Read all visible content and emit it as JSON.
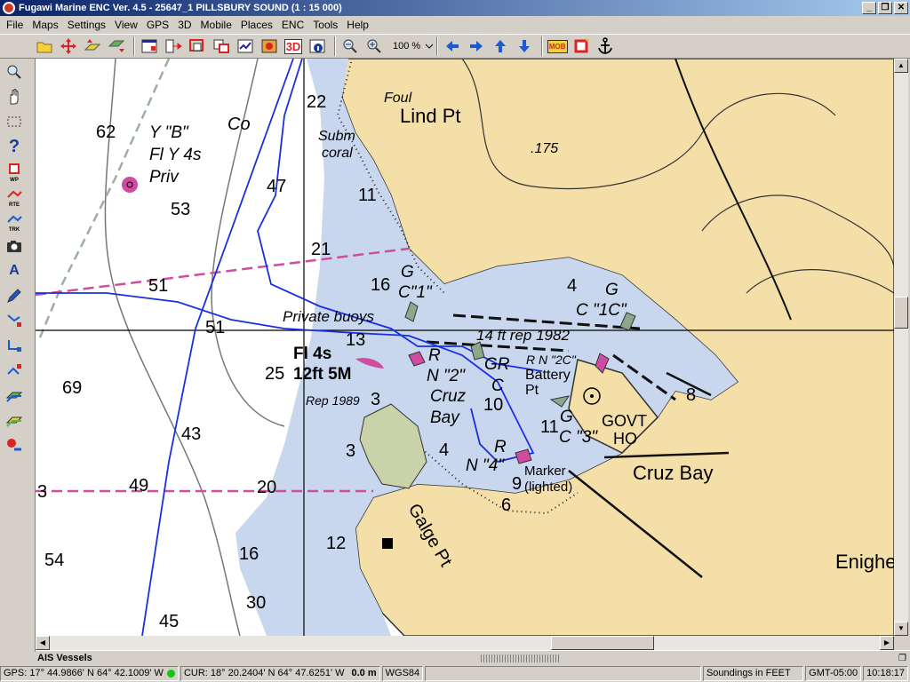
{
  "window": {
    "title": "Fugawi Marine ENC Ver. 4.5 - 25647_1  PILLSBURY SOUND  (1 : 15 000)",
    "buttons": [
      "_",
      "❐",
      "✕"
    ]
  },
  "menu": [
    "File",
    "Maps",
    "Settings",
    "View",
    "GPS",
    "3D",
    "Mobile",
    "Places",
    "ENC",
    "Tools",
    "Help"
  ],
  "toolbar": {
    "zoom_level": "100 %",
    "threed_label": "3D",
    "mob_label": "MOB"
  },
  "lefttools": {
    "wp_tag": "WP",
    "rte_tag": "RTE",
    "trk_tag": "TRK"
  },
  "chart": {
    "soundings": [
      {
        "v": "62"
      },
      {
        "v": "53"
      },
      {
        "v": "47"
      },
      {
        "v": "22"
      },
      {
        "v": "11"
      },
      {
        "v": "21"
      },
      {
        "v": "16"
      },
      {
        "v": "51"
      },
      {
        "v": "51"
      },
      {
        "v": "13"
      },
      {
        "v": "69"
      },
      {
        "v": "25"
      },
      {
        "v": "3"
      },
      {
        "v": "43"
      },
      {
        "v": "3"
      },
      {
        "v": "49"
      },
      {
        "v": "20"
      },
      {
        "v": "4"
      },
      {
        "v": "10"
      },
      {
        "v": "9"
      },
      {
        "v": "6"
      },
      {
        "v": "12"
      },
      {
        "v": "16"
      },
      {
        "v": "54"
      },
      {
        "v": "30"
      },
      {
        "v": "45"
      },
      {
        "v": "4"
      },
      {
        "v": "8"
      },
      {
        "v": "11"
      },
      {
        "v": "3"
      }
    ],
    "labels": {
      "lind_pt": "Lind Pt",
      "foul": "Foul",
      "subm": "Subm",
      "coral": "coral",
      "co": "Co",
      "elev_175": ".175",
      "buoy_b1": "Y \"B\"",
      "buoy_b2": "Fl Y 4s",
      "buoy_b3": "Priv",
      "private_buoys": "Private buoys",
      "light1": "Fl 4s",
      "light2": "12ft 5M",
      "rep_14ft": "14 ft rep 1982",
      "g1": "G",
      "c1": "C\"1\"",
      "g1c": "G",
      "c1c": "C \"1C\"",
      "r_n2": "R",
      "n2": "N \"2\"",
      "gr": "GR",
      "gr_c": "C",
      "rn2c": "R N \"2C\"",
      "battery": "Battery",
      "battery_pt": "Pt",
      "cruz": "Cruz",
      "bay": "Bay",
      "rep_1989": "Rep 1989",
      "g3": "G",
      "c3": "C \"3\"",
      "govt": "GOVT",
      "ho": "HO",
      "r4": "R",
      "n4": "N \"4\"",
      "marker": "Marker",
      "lighted": "(lighted)",
      "cruz_bay": "Cruz Bay",
      "galge_pt": "Galge Pt",
      "enighed": "Enighe"
    }
  },
  "ais": {
    "label": "AIS Vessels"
  },
  "status": {
    "gps": "GPS: 17° 44.9866' N 64° 42.1009' W",
    "cur": "CUR: 18° 20.2404' N 64° 47.6251' W",
    "dist": "0.0 m",
    "datum": "WGS84",
    "soundings": "Soundings in FEET",
    "tz": "GMT-05:00",
    "time": "10:18:17"
  }
}
